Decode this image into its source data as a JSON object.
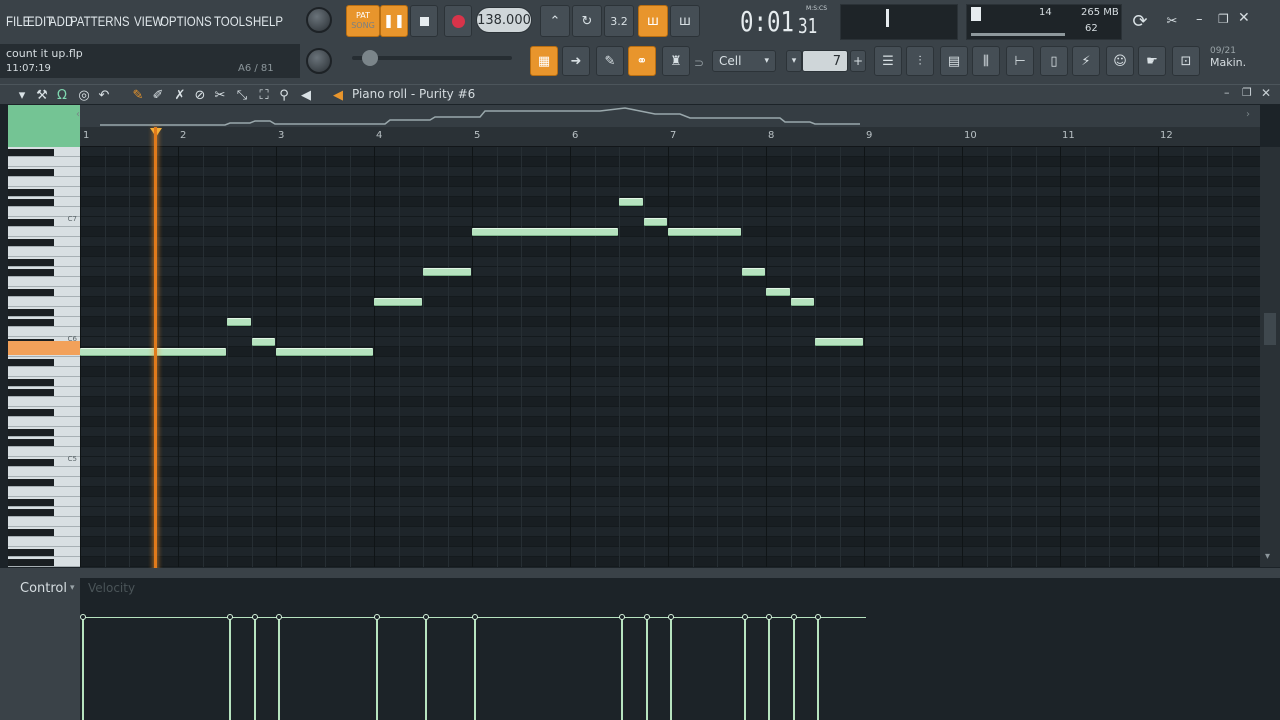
{
  "menu": [
    "FILE",
    "EDIT",
    "ADD",
    "PATTERNS",
    "VIEW",
    "OPTIONS",
    "TOOLS",
    "HELP"
  ],
  "hint": {
    "file": "count it up.flp",
    "time": "11:07:19",
    "pos": "A6 / 81"
  },
  "transport": {
    "pat": "PAT",
    "song": "SONG",
    "tempo": "138.000",
    "clock": "0:01",
    "clock_sub": "31",
    "clock_unit": "M:S:CS"
  },
  "snap": {
    "label": "Cell",
    "value": "7"
  },
  "meters": {
    "voices": "14",
    "ram": "265 MB",
    "cpu": "62"
  },
  "news": {
    "date": "09/21",
    "text": "Makin."
  },
  "pianoroll": {
    "title": "Piano roll - Purity #6",
    "ruler": [
      "1",
      "2",
      "3",
      "4",
      "5",
      "6",
      "7",
      "8",
      "9",
      "10",
      "11",
      "12"
    ],
    "key_labels": [
      "C7",
      "C6",
      "C5"
    ]
  },
  "control": {
    "label": "Control",
    "target": "Velocity"
  }
}
